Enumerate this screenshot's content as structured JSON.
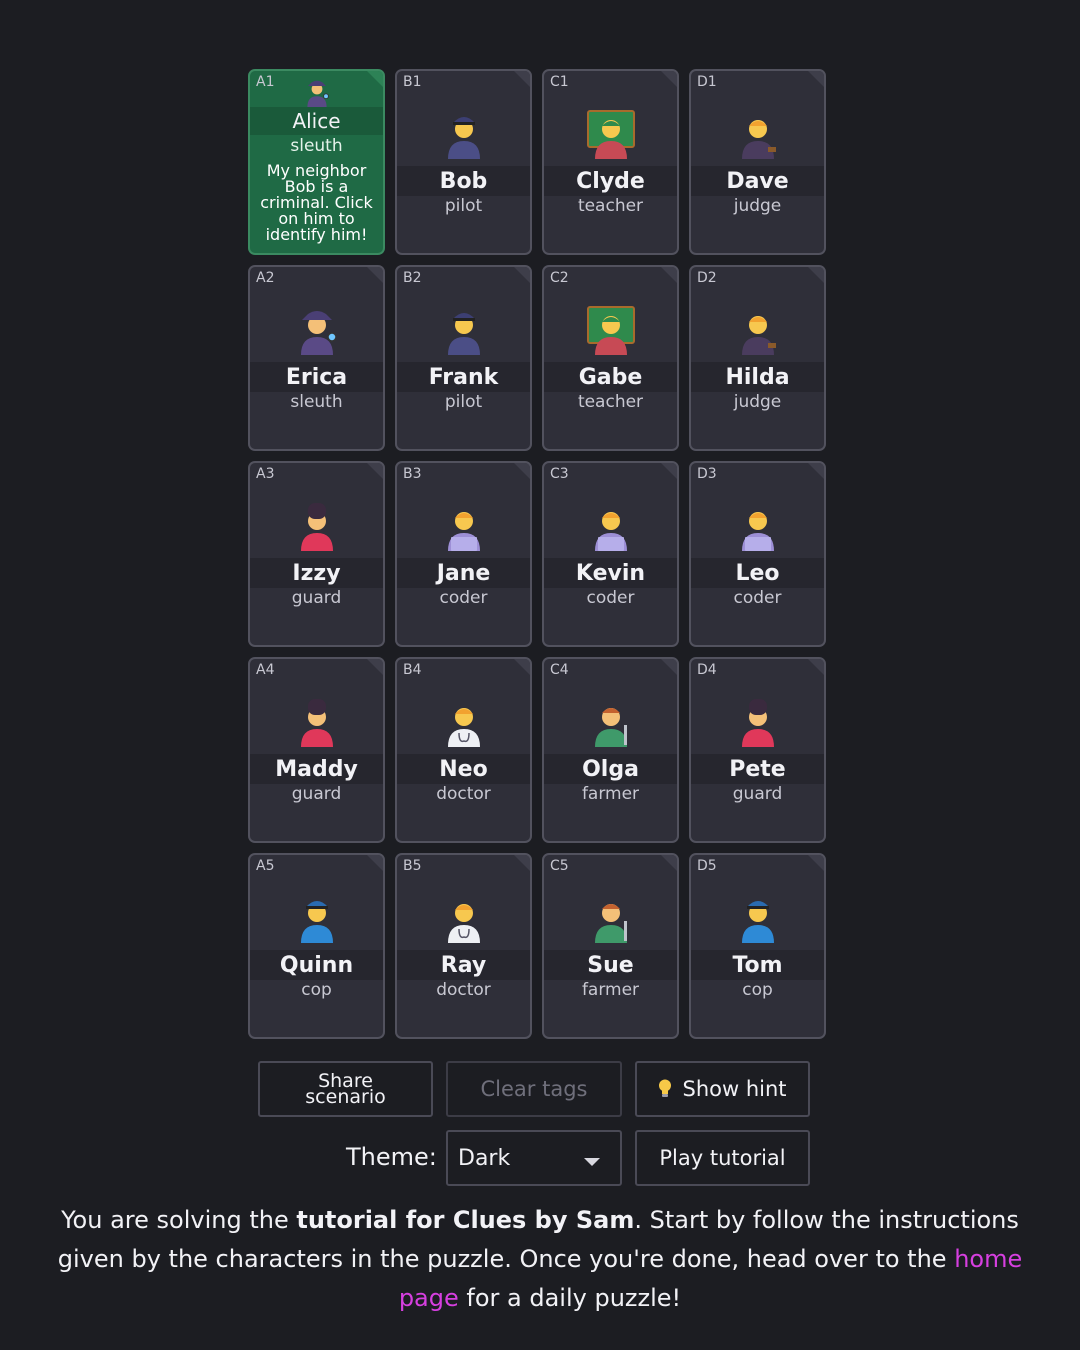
{
  "cards": [
    {
      "coord": "A1",
      "name": "Alice",
      "profession": "sleuth",
      "hint": "My neighbor Bob is a criminal. Click on him to identify him!",
      "revealed": true,
      "icon": "sleuth-icon",
      "skin": "#f4c078",
      "outfit": "#5a4a86",
      "hat": "#4a3f75"
    },
    {
      "coord": "B1",
      "name": "Bob",
      "profession": "pilot",
      "revealed": false,
      "icon": "pilot-icon",
      "skin": "#f7c84f",
      "outfit": "#4b4e86",
      "hat": "#3c3f73"
    },
    {
      "coord": "C1",
      "name": "Clyde",
      "profession": "teacher",
      "revealed": false,
      "icon": "teacher-icon",
      "skin": "#f7c84f",
      "outfit": "#c74a55",
      "hat": "#2f8a4c"
    },
    {
      "coord": "D1",
      "name": "Dave",
      "profession": "judge",
      "revealed": false,
      "icon": "judge-icon",
      "skin": "#f7c84f",
      "outfit": "#4a3c5e",
      "hat": "#f2a22f"
    },
    {
      "coord": "A2",
      "name": "Erica",
      "profession": "sleuth",
      "revealed": false,
      "icon": "sleuth-icon",
      "skin": "#f4c078",
      "outfit": "#5a4a86",
      "hat": "#4a3f75"
    },
    {
      "coord": "B2",
      "name": "Frank",
      "profession": "pilot",
      "revealed": false,
      "icon": "pilot-icon",
      "skin": "#f7c84f",
      "outfit": "#4b4e86",
      "hat": "#3c3f73"
    },
    {
      "coord": "C2",
      "name": "Gabe",
      "profession": "teacher",
      "revealed": false,
      "icon": "teacher-icon",
      "skin": "#f7c84f",
      "outfit": "#c74a55",
      "hat": "#2f8a4c"
    },
    {
      "coord": "D2",
      "name": "Hilda",
      "profession": "judge",
      "revealed": false,
      "icon": "judge-icon",
      "skin": "#f7c84f",
      "outfit": "#4a3c5e",
      "hat": "#f2a22f"
    },
    {
      "coord": "A3",
      "name": "Izzy",
      "profession": "guard",
      "revealed": false,
      "icon": "guard-icon",
      "skin": "#f4c078",
      "outfit": "#e0385a",
      "hat": "#3a2a3e"
    },
    {
      "coord": "B3",
      "name": "Jane",
      "profession": "coder",
      "revealed": false,
      "icon": "coder-icon",
      "skin": "#f7c84f",
      "outfit": "#9d8fd6",
      "hat": "#f2a22f"
    },
    {
      "coord": "C3",
      "name": "Kevin",
      "profession": "coder",
      "revealed": false,
      "icon": "coder-icon",
      "skin": "#f7c84f",
      "outfit": "#9d8fd6",
      "hat": "#f2a22f"
    },
    {
      "coord": "D3",
      "name": "Leo",
      "profession": "coder",
      "revealed": false,
      "icon": "coder-icon",
      "skin": "#f7c84f",
      "outfit": "#9d8fd6",
      "hat": "#f2a22f"
    },
    {
      "coord": "A4",
      "name": "Maddy",
      "profession": "guard",
      "revealed": false,
      "icon": "guard-icon",
      "skin": "#f4c078",
      "outfit": "#e0385a",
      "hat": "#3a2a3e"
    },
    {
      "coord": "B4",
      "name": "Neo",
      "profession": "doctor",
      "revealed": false,
      "icon": "doctor-icon",
      "skin": "#f7c84f",
      "outfit": "#eef0f4",
      "hat": "#f2a22f"
    },
    {
      "coord": "C4",
      "name": "Olga",
      "profession": "farmer",
      "revealed": false,
      "icon": "farmer-icon",
      "skin": "#f4c078",
      "outfit": "#3f9a6a",
      "hat": "#c4622f"
    },
    {
      "coord": "D4",
      "name": "Pete",
      "profession": "guard",
      "revealed": false,
      "icon": "guard-icon",
      "skin": "#f4c078",
      "outfit": "#e0385a",
      "hat": "#3a2a3e"
    },
    {
      "coord": "A5",
      "name": "Quinn",
      "profession": "cop",
      "revealed": false,
      "icon": "cop-icon",
      "skin": "#f7c84f",
      "outfit": "#2e8ad6",
      "hat": "#2a6bb0"
    },
    {
      "coord": "B5",
      "name": "Ray",
      "profession": "doctor",
      "revealed": false,
      "icon": "doctor-icon",
      "skin": "#f7c84f",
      "outfit": "#eef0f4",
      "hat": "#f2a22f"
    },
    {
      "coord": "C5",
      "name": "Sue",
      "profession": "farmer",
      "revealed": false,
      "icon": "farmer-icon",
      "skin": "#f4c078",
      "outfit": "#3f9a6a",
      "hat": "#c4622f"
    },
    {
      "coord": "D5",
      "name": "Tom",
      "profession": "cop",
      "revealed": false,
      "icon": "cop-icon",
      "skin": "#f7c84f",
      "outfit": "#2e8ad6",
      "hat": "#2a6bb0"
    }
  ],
  "buttons": {
    "share": "Share scenario",
    "clear": "Clear tags",
    "hint": "Show hint",
    "tutorial": "Play tutorial"
  },
  "theme": {
    "label": "Theme:",
    "value": "Dark"
  },
  "footer": {
    "part1": "You are solving the ",
    "bold": "tutorial for Clues by Sam",
    "part2": ". Start by follow the instructions given by the characters in the puzzle. Once you're done, head over to the ",
    "link": "home page",
    "part3": " for a daily puzzle!"
  },
  "colors": {
    "background": "#1c1d22",
    "card": "#2f2f39",
    "revealed_card": "#1f6a45",
    "link": "#d63fe0"
  }
}
